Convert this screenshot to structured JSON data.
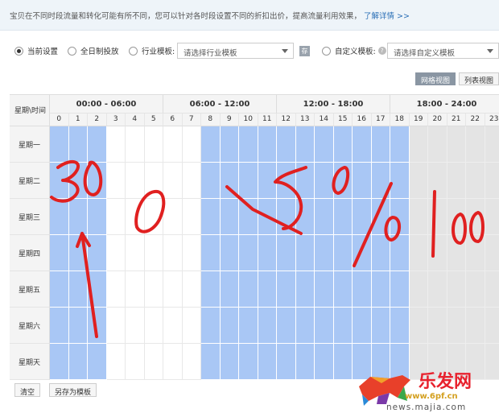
{
  "notice": {
    "text": "宝贝在不同时段流量和转化可能有所不同，您可以针对各时段设置不同的折扣出价，提高流量利用效果，",
    "link": "了解详情 >>"
  },
  "settings": {
    "current": "当前设置",
    "all_day": "全日制投放",
    "industry": "行业模板:",
    "industry_placeholder": "请选择行业模板",
    "save_icon": "存",
    "custom": "自定义模板:",
    "help": "?",
    "custom_placeholder": "请选择自定义模板",
    "selected": "current"
  },
  "views": {
    "grid": "网格视图",
    "list": "列表视图",
    "active": "grid"
  },
  "schedule": {
    "corner": "星期\\时间",
    "periods": [
      "00:00 - 06:00",
      "06:00 - 12:00",
      "12:00 - 18:00",
      "18:00 - 24:00"
    ],
    "hours": [
      "0",
      "1",
      "2",
      "3",
      "4",
      "5",
      "6",
      "7",
      "8",
      "9",
      "10",
      "11",
      "12",
      "13",
      "14",
      "15",
      "16",
      "17",
      "18",
      "19",
      "20",
      "21",
      "22",
      "23"
    ],
    "days": [
      "星期一",
      "星期二",
      "星期三",
      "星期四",
      "星期五",
      "星期六",
      "星期天"
    ],
    "hour_state": [
      "blue",
      "blue",
      "blue",
      "white",
      "white",
      "white",
      "white",
      "white",
      "blue",
      "blue",
      "blue",
      "blue",
      "blue",
      "blue",
      "blue",
      "blue",
      "blue",
      "blue",
      "blue",
      "grey",
      "grey",
      "grey",
      "grey",
      "grey"
    ]
  },
  "annotations": [
    "30",
    "0",
    "50%",
    "100"
  ],
  "buttons": {
    "clear": "清空",
    "save_template": "另存为模板"
  },
  "watermark": {
    "name": "乐发网",
    "url": "www.6pf.cn",
    "sub": "news.majia.com"
  },
  "colors": {
    "selected_cell": "#a9c7f5",
    "disabled_cell": "#e4e4e4",
    "handwriting": "#e02020",
    "link": "#2b6fb6"
  }
}
